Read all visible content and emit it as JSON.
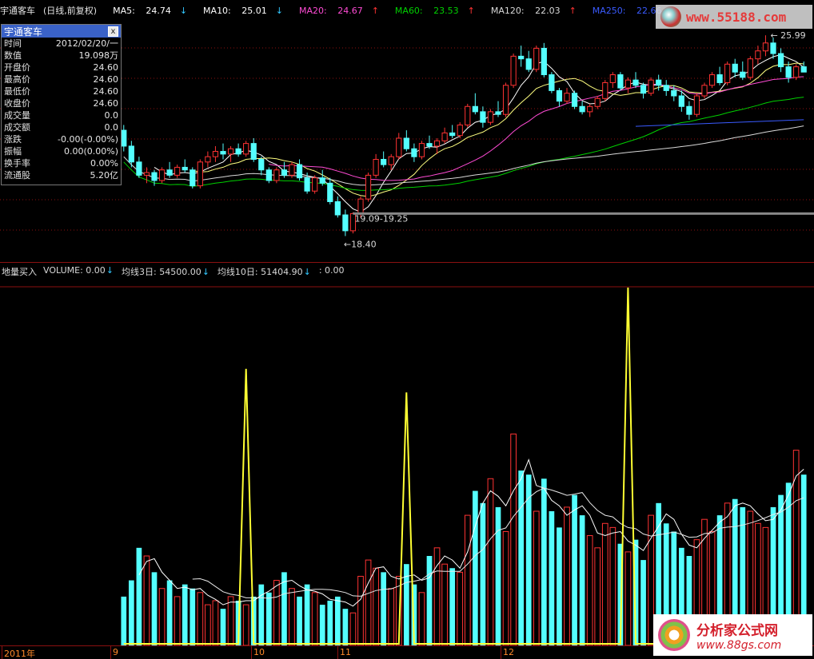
{
  "stock_name": "宇通客车",
  "period_label": "(日线,前复权)",
  "ma_legend": [
    {
      "label": "MA5:",
      "value": "24.74",
      "dir": "down",
      "cls": "ma5"
    },
    {
      "label": "MA10:",
      "value": "25.01",
      "dir": "down",
      "cls": "ma10"
    },
    {
      "label": "MA20:",
      "value": "24.67",
      "dir": "up",
      "cls": "ma20"
    },
    {
      "label": "MA60:",
      "value": "23.53",
      "dir": "up",
      "cls": "ma60"
    },
    {
      "label": "MA120:",
      "value": "22.03",
      "dir": "up",
      "cls": "ma120"
    },
    {
      "label": "MA250:",
      "value": "22.66",
      "dir": "up",
      "cls": "ma250"
    }
  ],
  "colors": {
    "bull": "#ff3333",
    "bear": "#54ffff",
    "ma5": "#ffffff",
    "ma10": "#ffff80",
    "ma20": "#ff4bd5",
    "ma60": "#00d000",
    "ma120": "#d8d8d8",
    "ma250": "#3a5bff",
    "signal": "#ffff33",
    "grid": "#8b1010"
  },
  "info_box": {
    "title": "宇通客车",
    "close_label": "x",
    "rows": [
      {
        "k": "时间",
        "v": "2012/02/20/一"
      },
      {
        "k": "数值",
        "v": "19.098万"
      },
      {
        "k": "开盘价",
        "v": "24.60"
      },
      {
        "k": "最高价",
        "v": "24.60"
      },
      {
        "k": "最低价",
        "v": "24.60"
      },
      {
        "k": "收盘价",
        "v": "24.60"
      },
      {
        "k": "成交量",
        "v": "0.0"
      },
      {
        "k": "成交额",
        "v": "0.0"
      },
      {
        "k": "涨跌",
        "v": "-0.00(-0.00%)"
      },
      {
        "k": "振幅",
        "v": "0.00(0.00%)"
      },
      {
        "k": "换手率",
        "v": "0.00%"
      },
      {
        "k": "流通股",
        "v": "5.20亿"
      }
    ]
  },
  "annotations": {
    "high_label": "25.99",
    "low_label": "←18.40",
    "range_label": "19.09-19.25"
  },
  "volume_panel": {
    "title": "地量买入",
    "items": [
      {
        "label": "VOLUME:",
        "value": "0.00",
        "dir": "down"
      },
      {
        "label": "均线3日:",
        "value": "54500.00",
        "dir": "down"
      },
      {
        "label": "均线10日:",
        "value": "51404.90",
        "dir": "down"
      },
      {
        "label": ":",
        "value": "0.00",
        "dir": ""
      }
    ]
  },
  "x_axis": {
    "labels": [
      "2011年",
      "9",
      "10",
      "11",
      "12"
    ]
  },
  "watermarks": {
    "top": "www.55188.com",
    "bottom_cn": "分析家公式网",
    "bottom_url": "www.88gs.com"
  },
  "chart_data": {
    "type": "candlestick",
    "price_range": [
      17.6,
      26.6
    ],
    "volume_range": [
      0,
      440000
    ],
    "signal_spikes": [
      {
        "index": 16,
        "value": 340000
      },
      {
        "index": 37,
        "value": 311000
      },
      {
        "index": 66,
        "value": 440000
      }
    ],
    "ohlc": [
      [
        22.4,
        22.6,
        21.6,
        21.8
      ],
      [
        21.8,
        22.0,
        21.0,
        21.2
      ],
      [
        21.2,
        21.4,
        20.6,
        20.7
      ],
      [
        20.7,
        21.0,
        20.4,
        20.8
      ],
      [
        20.8,
        20.9,
        20.3,
        20.5
      ],
      [
        20.5,
        21.0,
        20.4,
        20.9
      ],
      [
        20.9,
        21.2,
        20.6,
        20.7
      ],
      [
        20.7,
        21.1,
        20.6,
        21.0
      ],
      [
        21.0,
        21.3,
        20.8,
        20.9
      ],
      [
        20.9,
        21.0,
        20.2,
        20.3
      ],
      [
        20.3,
        21.3,
        20.2,
        21.2
      ],
      [
        21.2,
        21.6,
        21.0,
        21.4
      ],
      [
        21.4,
        21.8,
        21.2,
        21.6
      ],
      [
        21.6,
        21.9,
        21.3,
        21.5
      ],
      [
        21.5,
        21.8,
        21.2,
        21.7
      ],
      [
        21.7,
        21.9,
        21.4,
        21.5
      ],
      [
        21.5,
        22.0,
        21.4,
        21.9
      ],
      [
        21.9,
        22.1,
        21.2,
        21.3
      ],
      [
        21.3,
        21.4,
        20.7,
        20.9
      ],
      [
        20.9,
        21.0,
        20.4,
        20.5
      ],
      [
        20.5,
        21.0,
        20.4,
        20.9
      ],
      [
        20.9,
        21.2,
        20.6,
        20.7
      ],
      [
        20.7,
        21.2,
        20.6,
        21.1
      ],
      [
        21.1,
        21.3,
        20.5,
        20.6
      ],
      [
        20.6,
        20.8,
        20.0,
        20.1
      ],
      [
        20.1,
        20.7,
        20.0,
        20.6
      ],
      [
        20.6,
        20.9,
        20.3,
        20.4
      ],
      [
        20.4,
        20.6,
        19.6,
        19.7
      ],
      [
        19.7,
        19.9,
        19.1,
        19.2
      ],
      [
        19.2,
        19.4,
        18.4,
        18.6
      ],
      [
        18.6,
        19.3,
        18.5,
        19.25
      ],
      [
        19.25,
        19.9,
        19.1,
        19.8
      ],
      [
        19.8,
        20.8,
        19.7,
        20.7
      ],
      [
        20.7,
        21.5,
        20.6,
        21.3
      ],
      [
        21.3,
        21.6,
        21.0,
        21.1
      ],
      [
        21.1,
        21.5,
        20.9,
        21.4
      ],
      [
        21.4,
        22.3,
        21.3,
        22.1
      ],
      [
        22.1,
        22.4,
        21.6,
        21.7
      ],
      [
        21.7,
        21.9,
        21.2,
        21.4
      ],
      [
        21.4,
        22.0,
        21.3,
        21.9
      ],
      [
        21.9,
        22.2,
        21.7,
        21.8
      ],
      [
        21.8,
        22.1,
        21.5,
        22.0
      ],
      [
        22.0,
        22.5,
        21.9,
        22.3
      ],
      [
        22.3,
        22.6,
        22.1,
        22.2
      ],
      [
        22.2,
        22.7,
        22.1,
        22.6
      ],
      [
        22.6,
        23.4,
        22.5,
        23.3
      ],
      [
        23.3,
        23.8,
        23.0,
        23.1
      ],
      [
        23.1,
        23.3,
        22.5,
        22.7
      ],
      [
        22.7,
        23.2,
        22.6,
        23.1
      ],
      [
        23.1,
        23.5,
        22.9,
        23.0
      ],
      [
        23.0,
        24.2,
        22.9,
        24.1
      ],
      [
        24.1,
        25.3,
        24.0,
        25.2
      ],
      [
        25.2,
        25.6,
        24.8,
        25.1
      ],
      [
        25.1,
        25.4,
        24.6,
        24.7
      ],
      [
        24.7,
        25.6,
        24.6,
        25.5
      ],
      [
        25.5,
        25.7,
        24.4,
        24.5
      ],
      [
        24.5,
        24.6,
        23.8,
        23.9
      ],
      [
        23.9,
        24.0,
        23.3,
        23.5
      ],
      [
        23.5,
        24.0,
        23.4,
        23.8
      ],
      [
        23.8,
        23.9,
        23.2,
        23.3
      ],
      [
        23.3,
        23.5,
        23.0,
        23.1
      ],
      [
        23.1,
        23.4,
        22.9,
        23.3
      ],
      [
        23.3,
        23.7,
        23.2,
        23.6
      ],
      [
        23.6,
        24.3,
        23.5,
        24.2
      ],
      [
        24.2,
        24.6,
        24.0,
        24.5
      ],
      [
        24.5,
        24.6,
        23.9,
        24.0
      ],
      [
        24.0,
        24.4,
        23.8,
        24.3
      ],
      [
        24.3,
        24.6,
        24.0,
        24.1
      ],
      [
        24.1,
        24.2,
        23.6,
        23.8
      ],
      [
        23.8,
        24.4,
        23.7,
        24.3
      ],
      [
        24.3,
        24.5,
        23.9,
        24.1
      ],
      [
        24.1,
        24.3,
        23.7,
        23.9
      ],
      [
        23.9,
        24.1,
        23.5,
        23.7
      ],
      [
        23.7,
        23.9,
        23.1,
        23.3
      ],
      [
        23.3,
        23.5,
        22.8,
        23.0
      ],
      [
        23.0,
        23.8,
        22.9,
        23.7
      ],
      [
        23.7,
        24.2,
        23.6,
        24.1
      ],
      [
        24.1,
        24.6,
        24.0,
        24.5
      ],
      [
        24.5,
        24.8,
        24.1,
        24.2
      ],
      [
        24.2,
        25.0,
        24.1,
        24.9
      ],
      [
        24.9,
        25.1,
        24.4,
        24.6
      ],
      [
        24.6,
        25.0,
        24.3,
        24.4
      ],
      [
        24.4,
        25.2,
        24.3,
        25.1
      ],
      [
        25.1,
        25.6,
        24.9,
        25.4
      ],
      [
        25.4,
        25.99,
        25.2,
        25.7
      ],
      [
        25.7,
        25.9,
        25.1,
        25.3
      ],
      [
        25.3,
        25.5,
        24.6,
        24.8
      ],
      [
        24.8,
        25.0,
        24.2,
        24.4
      ],
      [
        24.4,
        24.9,
        24.3,
        24.8
      ],
      [
        24.8,
        25.0,
        24.6,
        24.6
      ]
    ],
    "volume": [
      60000,
      80000,
      120000,
      110000,
      90000,
      70000,
      80000,
      60000,
      75000,
      70000,
      65000,
      50000,
      55000,
      45000,
      60000,
      55000,
      50000,
      60000,
      75000,
      65000,
      80000,
      90000,
      70000,
      60000,
      75000,
      65000,
      50000,
      55000,
      60000,
      45000,
      40000,
      85000,
      105000,
      95000,
      90000,
      70000,
      85000,
      100000,
      75000,
      65000,
      110000,
      120000,
      100000,
      95000,
      90000,
      160000,
      190000,
      175000,
      205000,
      170000,
      140000,
      260000,
      215000,
      210000,
      165000,
      205000,
      165000,
      145000,
      170000,
      185000,
      160000,
      135000,
      120000,
      150000,
      145000,
      125000,
      115000,
      130000,
      105000,
      160000,
      175000,
      150000,
      140000,
      120000,
      110000,
      130000,
      155000,
      140000,
      160000,
      175000,
      180000,
      170000,
      165000,
      150000,
      145000,
      170000,
      185000,
      200000,
      240000,
      210000
    ],
    "volume_bull": [
      0,
      0,
      0,
      1,
      0,
      1,
      0,
      1,
      0,
      0,
      1,
      1,
      1,
      0,
      1,
      0,
      1,
      0,
      0,
      0,
      1,
      0,
      1,
      0,
      0,
      1,
      0,
      0,
      0,
      0,
      1,
      1,
      1,
      1,
      0,
      1,
      1,
      0,
      0,
      1,
      0,
      1,
      1,
      0,
      1,
      1,
      0,
      0,
      1,
      0,
      1,
      1,
      0,
      0,
      1,
      0,
      0,
      0,
      1,
      0,
      0,
      1,
      1,
      1,
      1,
      0,
      1,
      0,
      0,
      1,
      0,
      0,
      0,
      0,
      0,
      1,
      1,
      1,
      0,
      1,
      0,
      0,
      1,
      1,
      1,
      0,
      0,
      0,
      1,
      0
    ]
  }
}
